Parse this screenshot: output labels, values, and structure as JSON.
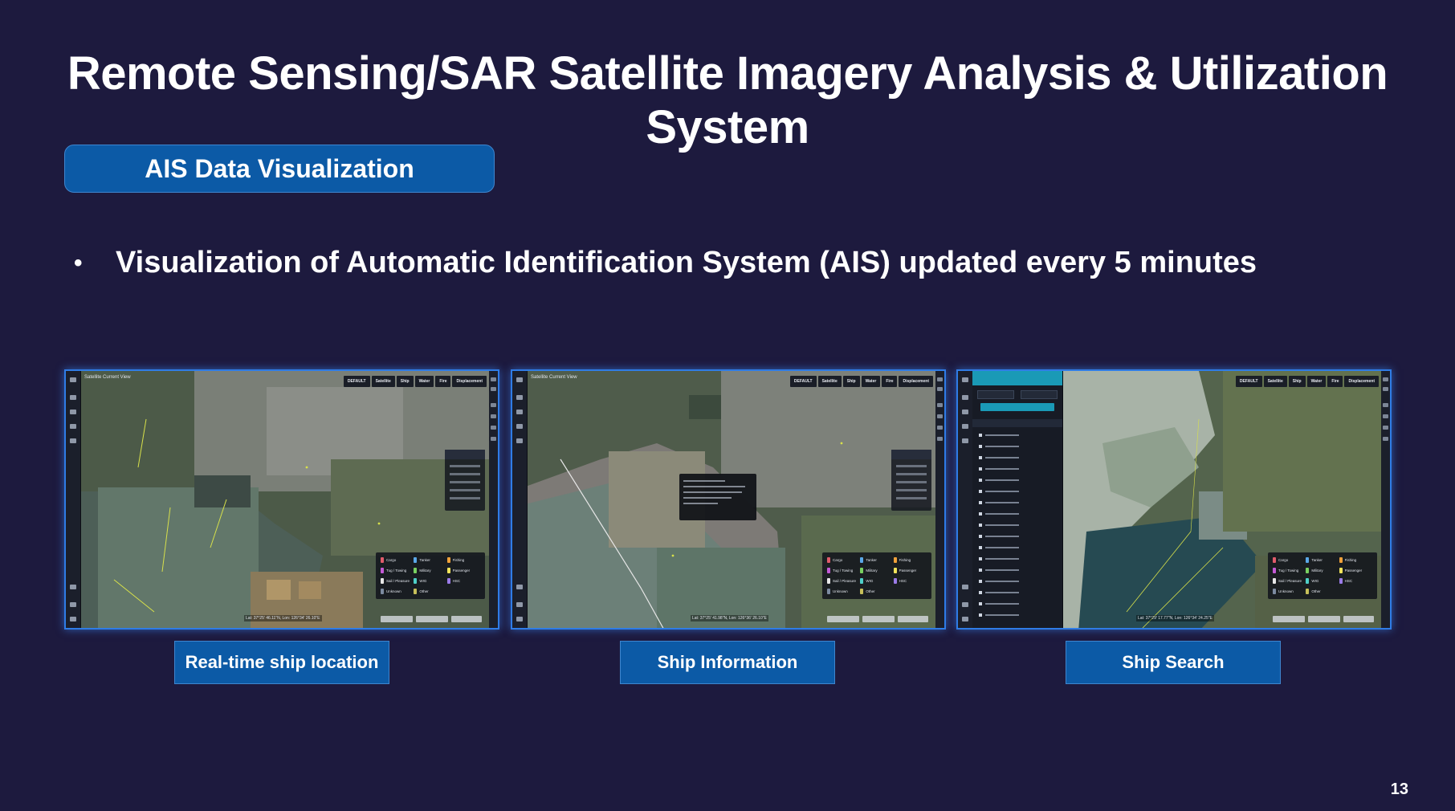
{
  "slide": {
    "title": "Remote Sensing/SAR Satellite Imagery Analysis & Utilization System",
    "section_tag": "AIS Data Visualization",
    "bullet": "Visualization of Automatic Identification System (AIS) updated every 5 minutes",
    "page_number": "13"
  },
  "panels": [
    {
      "caption": "Real-time ship location",
      "view_label": "Satellite Current View"
    },
    {
      "caption": "Ship Information",
      "view_label": "Satellite Current View"
    },
    {
      "caption": "Ship Search",
      "view_label": ""
    }
  ],
  "map_toolbar": {
    "buttons": [
      "DEFAULT",
      "Satellite",
      "Ship",
      "Water",
      "Fire",
      "Displacement"
    ]
  },
  "legend": {
    "items": [
      {
        "label": "Cargo",
        "color": "#e05b6a"
      },
      {
        "label": "Tanker",
        "color": "#5aa8e8"
      },
      {
        "label": "Fishing",
        "color": "#f0a13a"
      },
      {
        "label": "Tug / Towing",
        "color": "#c45ad6"
      },
      {
        "label": "Military",
        "color": "#7ad160"
      },
      {
        "label": "Passenger",
        "color": "#f2e35a"
      },
      {
        "label": "Sail / Pleasure",
        "color": "#e8e8e8"
      },
      {
        "label": "WIG",
        "color": "#4fd0c8"
      },
      {
        "label": "HSC",
        "color": "#9b7be8"
      },
      {
        "label": "Unknown",
        "color": "#7c8aa0"
      },
      {
        "label": "Other",
        "color": "#c7c05a"
      }
    ]
  },
  "coords": {
    "p1": "Lat: 37°25' 46.11\"N, Lon: 126°34' 26.10\"E",
    "p2": "Lat: 37°25' 41.98\"N, Lon: 126°36' 26.10\"E",
    "p3": "Lat: 37°29' 17.77\"N, Lon: 126°34' 24.25\"E"
  },
  "colors": {
    "background": "#1d1a3e",
    "accent": "#0c5aa6",
    "panel_border": "#2f7ce6"
  }
}
